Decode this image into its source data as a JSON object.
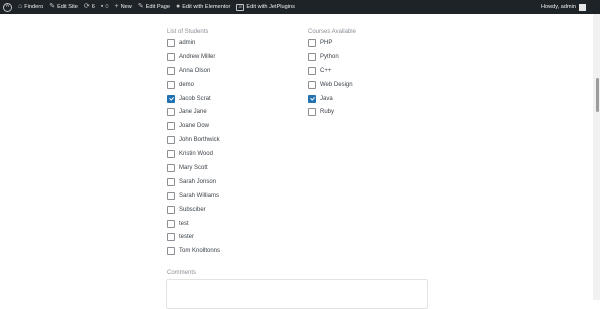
{
  "adminbar": {
    "site_name": "Findero",
    "edit_site": "Edit Site",
    "updates_count": "6",
    "comments_count": "0",
    "new_label": "New",
    "edit_page": "Edit Page",
    "elementor": "Edit with Elementor",
    "jetplugins": "Edit with JetPlugins",
    "greeting": "Howdy, admin",
    "colors": {
      "bar_bg": "#1d2327",
      "text": "#f0f0f1"
    }
  },
  "form": {
    "students_title": "List of Students",
    "students": [
      {
        "label": "admin",
        "checked": false
      },
      {
        "label": "Andrew Miller",
        "checked": false
      },
      {
        "label": "Anna Olson",
        "checked": false
      },
      {
        "label": "demo",
        "checked": false
      },
      {
        "label": "Jacob Scrat",
        "checked": true
      },
      {
        "label": "Jane Jane",
        "checked": false
      },
      {
        "label": "Joane Dow",
        "checked": false
      },
      {
        "label": "John Borthwick",
        "checked": false
      },
      {
        "label": "Kristin Wood",
        "checked": false
      },
      {
        "label": "Mary Scott",
        "checked": false
      },
      {
        "label": "Sarah Jonson",
        "checked": false
      },
      {
        "label": "Sarah Williams",
        "checked": false
      },
      {
        "label": "Subsciber",
        "checked": false
      },
      {
        "label": "test",
        "checked": false
      },
      {
        "label": "tester",
        "checked": false
      },
      {
        "label": "Tom Knolltonns",
        "checked": false
      }
    ],
    "courses_title": "Courses Available",
    "courses": [
      {
        "label": "PHP",
        "checked": false
      },
      {
        "label": "Python",
        "checked": false
      },
      {
        "label": "C++",
        "checked": false
      },
      {
        "label": "Web Design",
        "checked": false
      },
      {
        "label": "Java",
        "checked": true
      },
      {
        "label": "Ruby",
        "checked": false
      }
    ],
    "comments_label": "Comments",
    "comments_value": "",
    "colors": {
      "checkbox_checked": "#2271b1",
      "label": "#3c434a",
      "section_title": "#8a8f96"
    }
  }
}
